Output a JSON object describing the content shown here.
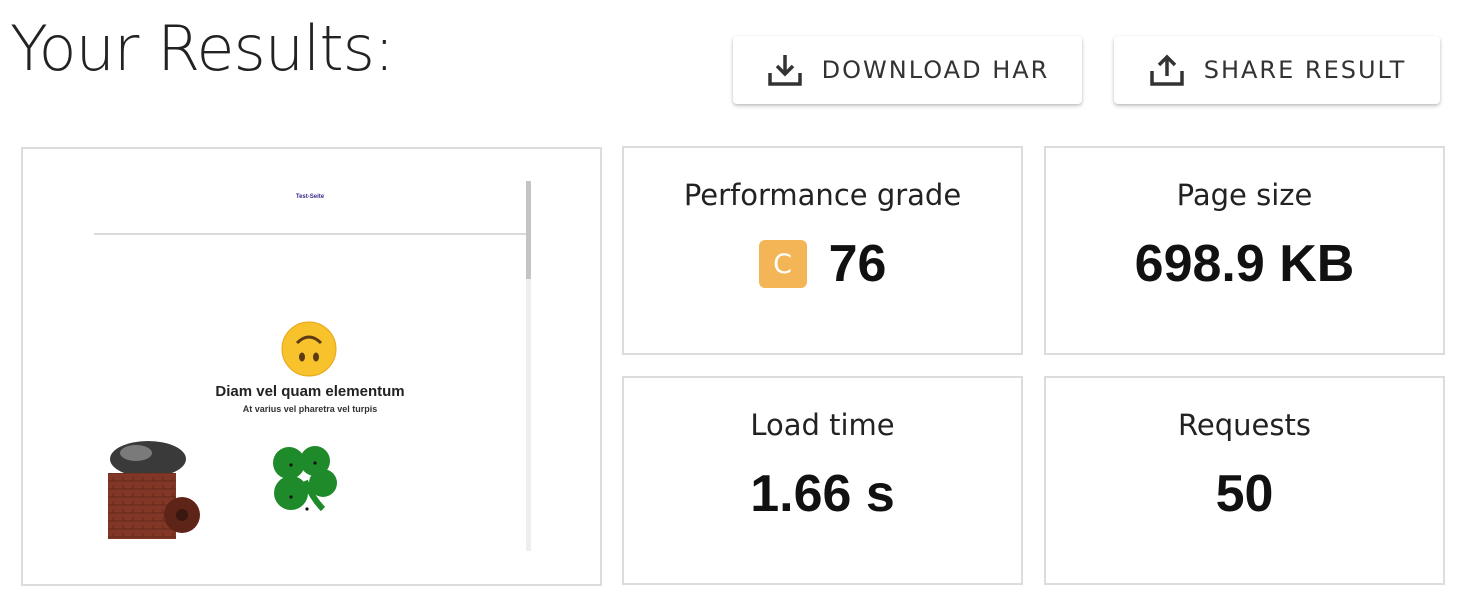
{
  "page": {
    "title": "Your Results:"
  },
  "actions": {
    "download_label": "DOWNLOAD HAR",
    "share_label": "SHARE RESULT"
  },
  "preview": {
    "site_header": "Test-Seite",
    "heading": "Diam vel quam elementum",
    "subheading": "At varius vel pharetra vel turpis"
  },
  "metrics": {
    "grade": {
      "label": "Performance grade",
      "letter": "C",
      "value": "76",
      "badge_color": "#f4b556"
    },
    "size": {
      "label": "Page size",
      "value": "698.9 KB"
    },
    "load": {
      "label": "Load time",
      "value": "1.66 s"
    },
    "requests": {
      "label": "Requests",
      "value": "50"
    }
  }
}
